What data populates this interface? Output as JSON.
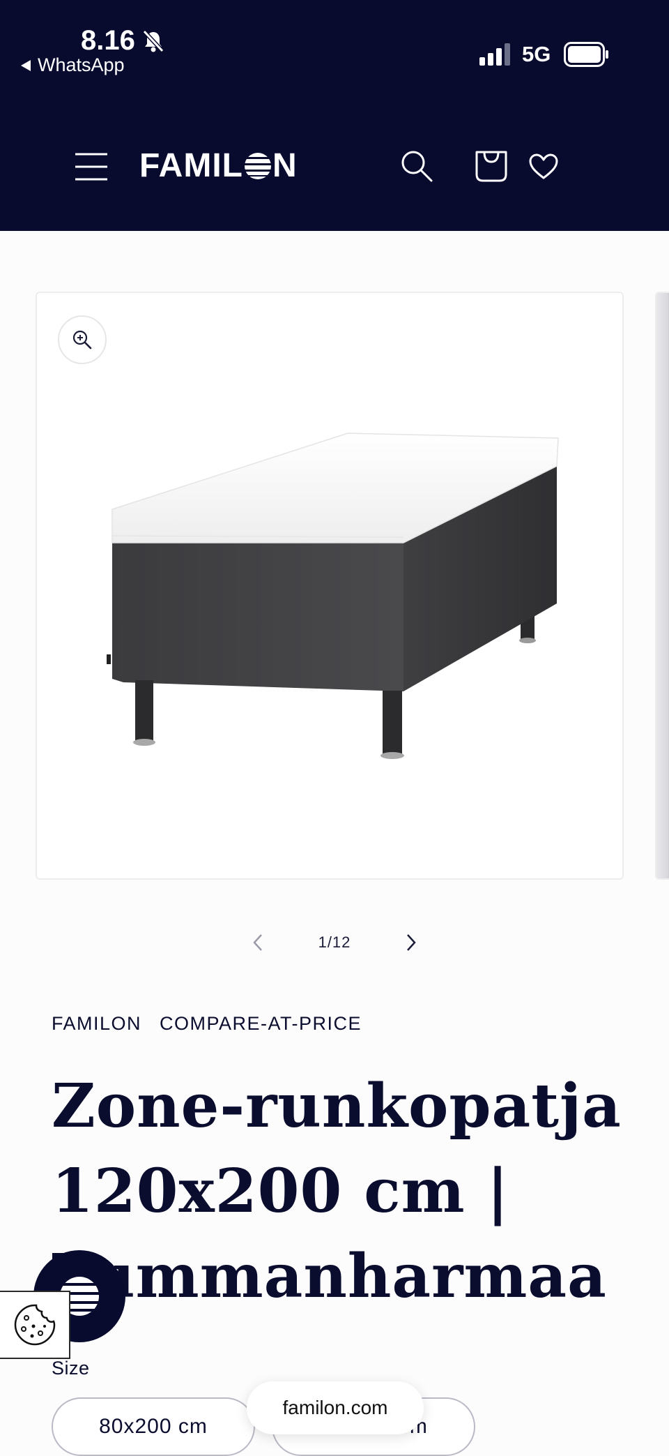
{
  "status_bar": {
    "time": "8.16",
    "back_app": "WhatsApp",
    "network": "5G"
  },
  "header": {
    "logo_text_before": "FAMIL",
    "logo_text_after": "N"
  },
  "gallery": {
    "counter": "1/12"
  },
  "product": {
    "vendor": "FAMILON",
    "vendor_tag": "COMPARE-AT-PRICE",
    "title_line1": "Zone-runkopatja",
    "title_line2": "120x200 cm |",
    "title_line3": "Tummanharmaa",
    "size_label": "Size",
    "sizes": [
      "80x200 cm",
      "90x200 cm"
    ]
  },
  "browser": {
    "url": "familon.com"
  },
  "colors": {
    "brand_navy": "#080b2e",
    "text": "#0a0d2e",
    "background": "#fcfcfc"
  }
}
